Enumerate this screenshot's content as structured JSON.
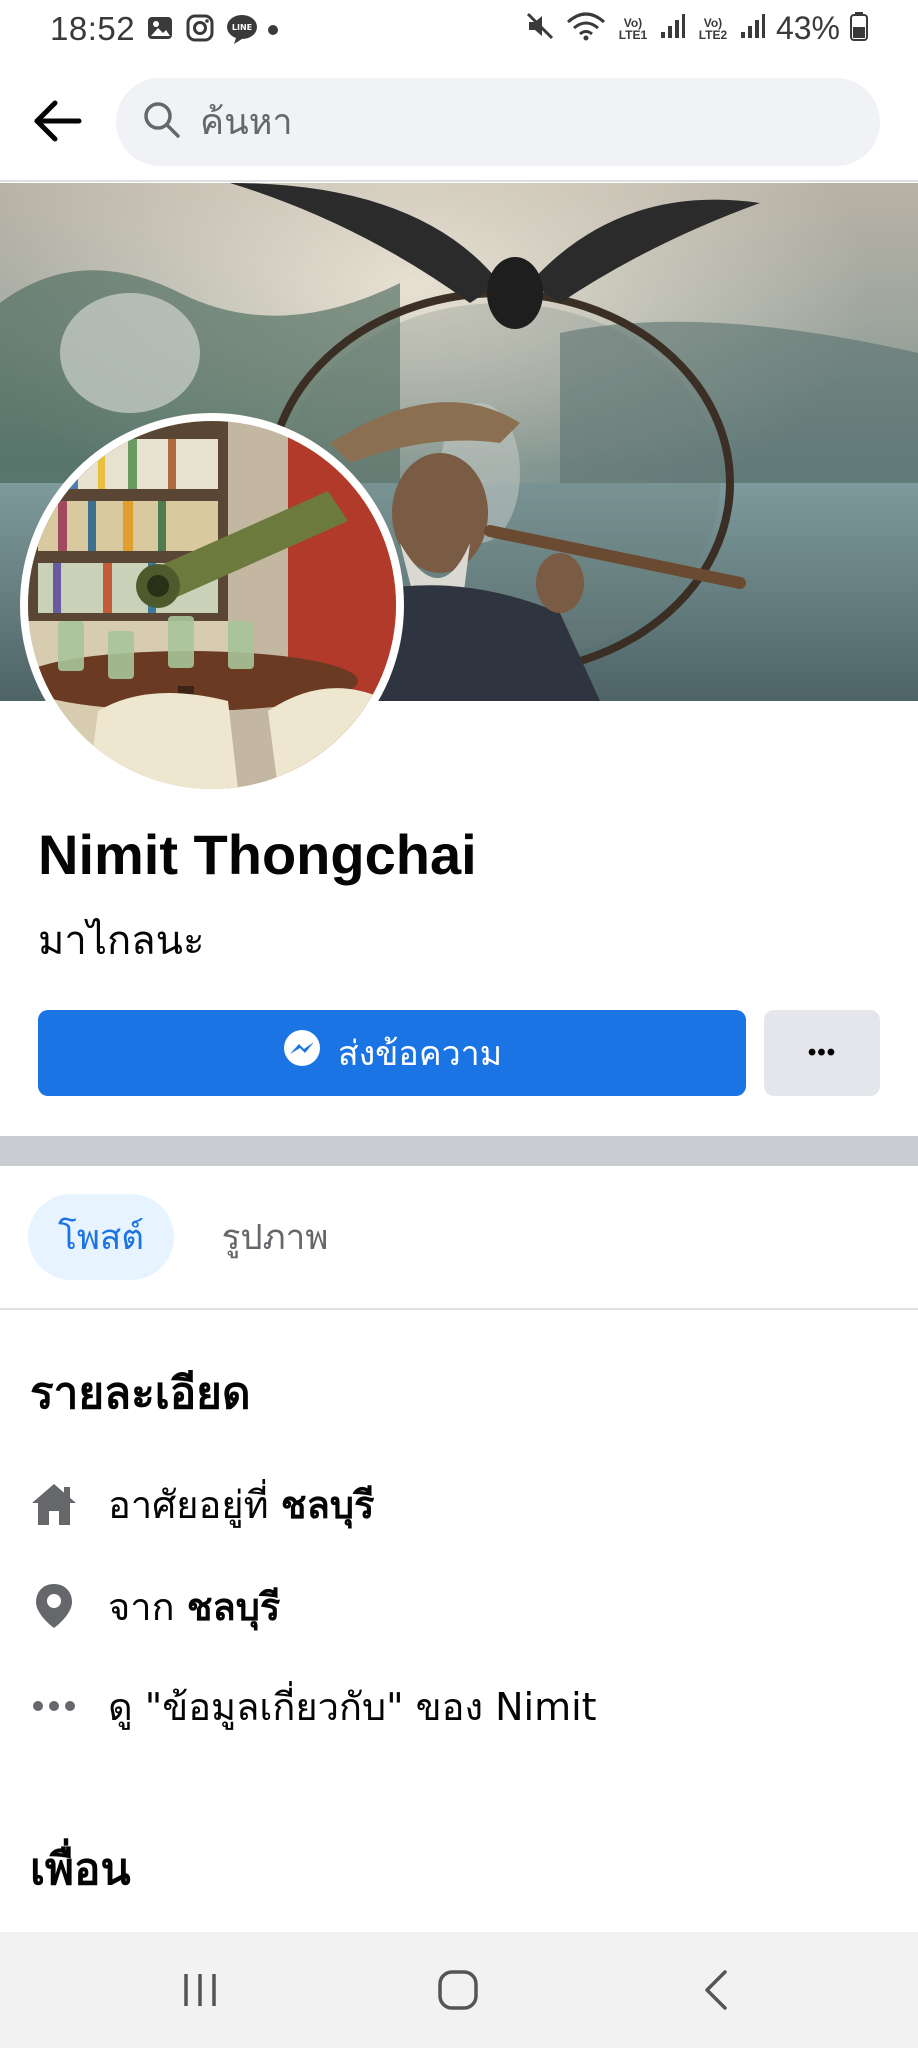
{
  "status_bar": {
    "time": "18:52",
    "battery": "43%",
    "sim1": "Vo) LTE1",
    "sim2": "Vo) LTE2",
    "left_icons": [
      "gallery-icon",
      "instagram-icon",
      "line-icon",
      "dot-icon"
    ],
    "right_icons": [
      "mute-icon",
      "wifi-icon",
      "signal-icon",
      "signal-icon",
      "battery-icon"
    ],
    "line_label": "LINE"
  },
  "search": {
    "placeholder": "ค้นหา"
  },
  "profile": {
    "name": "Nimit Thongchai",
    "bio": "มาไกลนะ"
  },
  "actions": {
    "message_label": "ส่งข้อความ",
    "more_label": "•••"
  },
  "tabs": [
    {
      "label": "โพสต์",
      "active": true
    },
    {
      "label": "รูปภาพ",
      "active": false
    }
  ],
  "details": {
    "title": "รายละเอียด",
    "lives_prefix": "อาศัยอยู่ที่",
    "lives_value": "ชลบุรี",
    "from_prefix": "จาก",
    "from_value": "ชลบุรี",
    "about_link": "ดู \"ข้อมูลเกี่ยวกับ\" ของ Nimit"
  },
  "friends": {
    "title": "เพื่อน"
  },
  "colors": {
    "accent": "#1b74e4",
    "tab_active_bg": "#e7f3ff",
    "secondary_bg": "#e4e6eb",
    "divider": "#c9ccd1"
  }
}
